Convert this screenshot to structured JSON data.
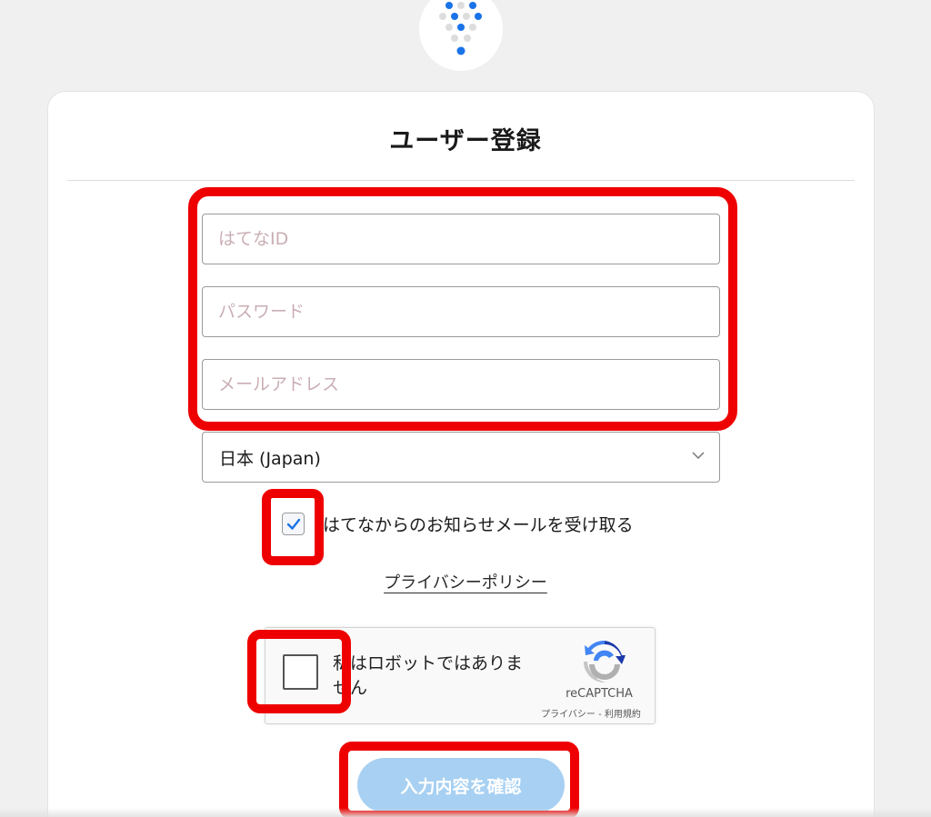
{
  "page": {
    "title": "ユーザー登録"
  },
  "form": {
    "id_placeholder": "はてなID",
    "password_placeholder": "パスワード",
    "email_placeholder": "メールアドレス",
    "country_selected": "日本 (Japan)",
    "newsletter_checked": true,
    "newsletter_label": "はてなからのお知らせメールを受け取る",
    "privacy_link": "プライバシーポリシー"
  },
  "recaptcha": {
    "label": "私はロボットではありません",
    "brand": "reCAPTCHA",
    "links": "プライバシー - 利用規約"
  },
  "submit": {
    "label": "入力内容を確認"
  },
  "colors": {
    "highlight": "#ee0000",
    "accent": "#1a73e8",
    "button_bg": "#a7d0f2"
  },
  "icons": {
    "logo": "hatena-dots-logo-icon",
    "chevron": "chevron-down-icon",
    "check": "checkmark-icon",
    "recaptcha": "recaptcha-logo-icon"
  }
}
